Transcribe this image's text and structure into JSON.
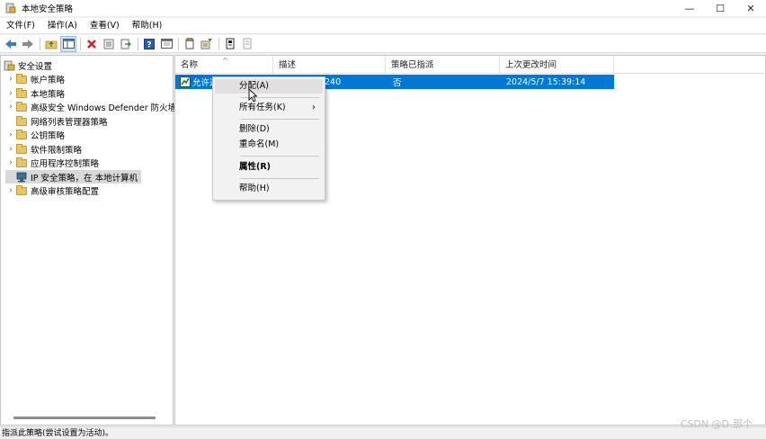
{
  "window": {
    "title": "本地安全策略",
    "minimize_glyph": "—",
    "maximize_glyph": "☐",
    "close_glyph": "✕"
  },
  "menubar": {
    "items": [
      "文件(F)",
      "操作(A)",
      "查看(V)",
      "帮助(H)"
    ]
  },
  "toolbar": {
    "icons": [
      "back-icon",
      "forward-icon",
      "up-folder-icon",
      "show-hide-tree-icon",
      "delete-icon",
      "properties-icon",
      "export-icon",
      "help-icon",
      "show-console-tree-icon",
      "new-policy-icon",
      "manage-filters-icon",
      "assign-icon",
      "unassign-icon"
    ]
  },
  "tree": {
    "root_label": "安全设置",
    "items": [
      {
        "label": "帐户策略",
        "expandable": true
      },
      {
        "label": "本地策略",
        "expandable": true
      },
      {
        "label": "高级安全 Windows Defender 防火墙",
        "expandable": true
      },
      {
        "label": "网络列表管理器策略",
        "expandable": false
      },
      {
        "label": "公钥策略",
        "expandable": true
      },
      {
        "label": "软件限制策略",
        "expandable": true
      },
      {
        "label": "应用程序控制策略",
        "expandable": true
      },
      {
        "label": "IP 安全策略，在 本地计算机",
        "expandable": false,
        "selected": true
      },
      {
        "label": "高级审核策略配置",
        "expandable": true
      }
    ]
  },
  "list": {
    "columns": [
      "名称",
      "描述",
      "策略已指派",
      "上次更改时间"
    ],
    "sort_glyph": "^",
    "rows": [
      {
        "name": "允许这",
        "desc": "240",
        "assigned": "否",
        "modified": "2024/5/7 15:39:14"
      }
    ]
  },
  "context_menu": {
    "items": [
      {
        "label": "分配(A)",
        "hover": true
      },
      {
        "label": "所有任务(K)",
        "submenu": true,
        "submenu_glyph": "›"
      },
      {
        "label": "删除(D)"
      },
      {
        "label": "重命名(M)"
      },
      {
        "label": "属性(R)",
        "bold": true
      },
      {
        "label": "帮助(H)"
      }
    ]
  },
  "statusbar": {
    "text": "指派此策略(尝试设置为活动)。"
  },
  "watermark": "CSDN @D-那个"
}
